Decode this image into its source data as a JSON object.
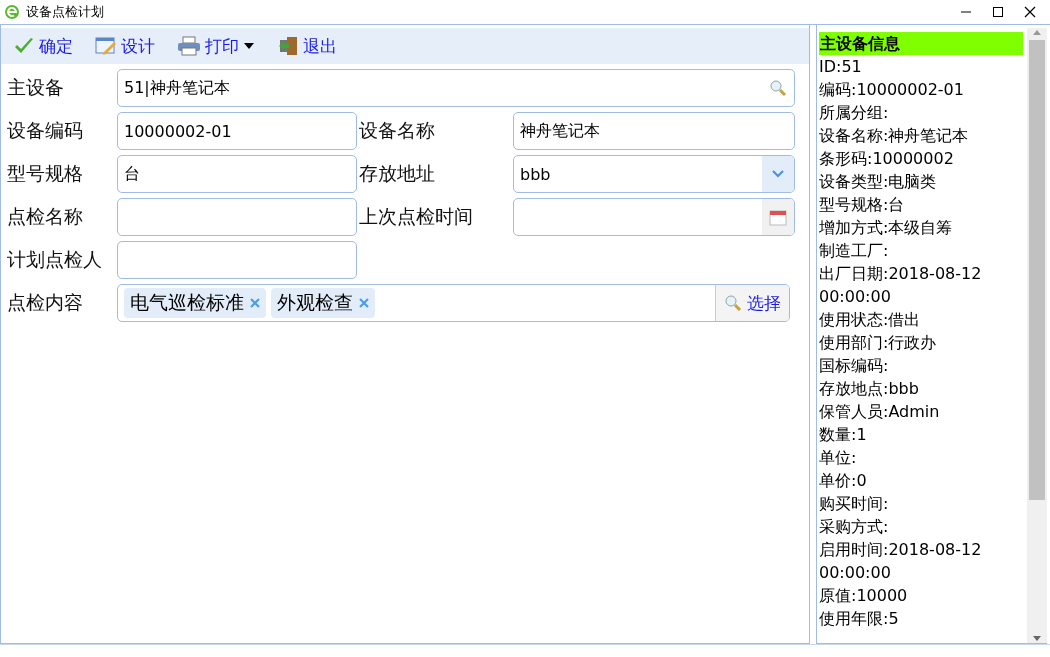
{
  "window": {
    "title": "设备点检计划"
  },
  "toolbar": [
    {
      "label": "确定",
      "kind": "ok",
      "dropdown": false
    },
    {
      "label": "设计",
      "kind": "design",
      "dropdown": false
    },
    {
      "label": "打印",
      "kind": "print",
      "dropdown": true
    },
    {
      "label": "退出",
      "kind": "exit",
      "dropdown": false
    }
  ],
  "form": [
    [
      {
        "label": "主设备",
        "kind": "search",
        "wide": true,
        "value": "51|神舟笔记本"
      }
    ],
    [
      {
        "label": "设备编码",
        "kind": "text",
        "wide": false,
        "value": "10000002-01"
      },
      {
        "label": "设备名称",
        "kind": "text",
        "wide": false,
        "value": "神舟笔记本"
      }
    ],
    [
      {
        "label": "型号规格",
        "kind": "text",
        "wide": false,
        "value": "台"
      },
      {
        "label": "存放地址",
        "kind": "select",
        "wide": false,
        "value": "bbb"
      }
    ],
    [
      {
        "label": "点检名称",
        "kind": "text",
        "wide": false
      },
      {
        "label": "上次点检时间",
        "kind": "date",
        "wide": false
      }
    ],
    [
      {
        "label": "计划点检人",
        "kind": "text",
        "wide": false
      }
    ],
    [
      {
        "label": "点检内容",
        "kind": "tags",
        "wide": true,
        "tags": [
          "电气巡检标准",
          "外观检查"
        ],
        "button": "选择"
      }
    ]
  ],
  "info_panel": {
    "title": "主设备信息",
    "lines": [
      "ID:51",
      "编码:10000002-01",
      "所属分组:",
      "设备名称:神舟笔记本",
      "条形码:10000002",
      "设备类型:电脑类",
      "型号规格:台",
      "增加方式:本级自筹",
      "制造工厂:",
      "出厂日期:2018-08-12",
      "00:00:00",
      "使用状态:借出",
      "使用部门:行政办",
      "国标编码:",
      "存放地点:bbb",
      "保管人员:Admin",
      "数量:1",
      "单位:",
      "单价:0",
      "购买时间:",
      "采购方式:",
      "启用时间:2018-08-12",
      "00:00:00",
      "原值:10000",
      "使用年限:5"
    ]
  }
}
